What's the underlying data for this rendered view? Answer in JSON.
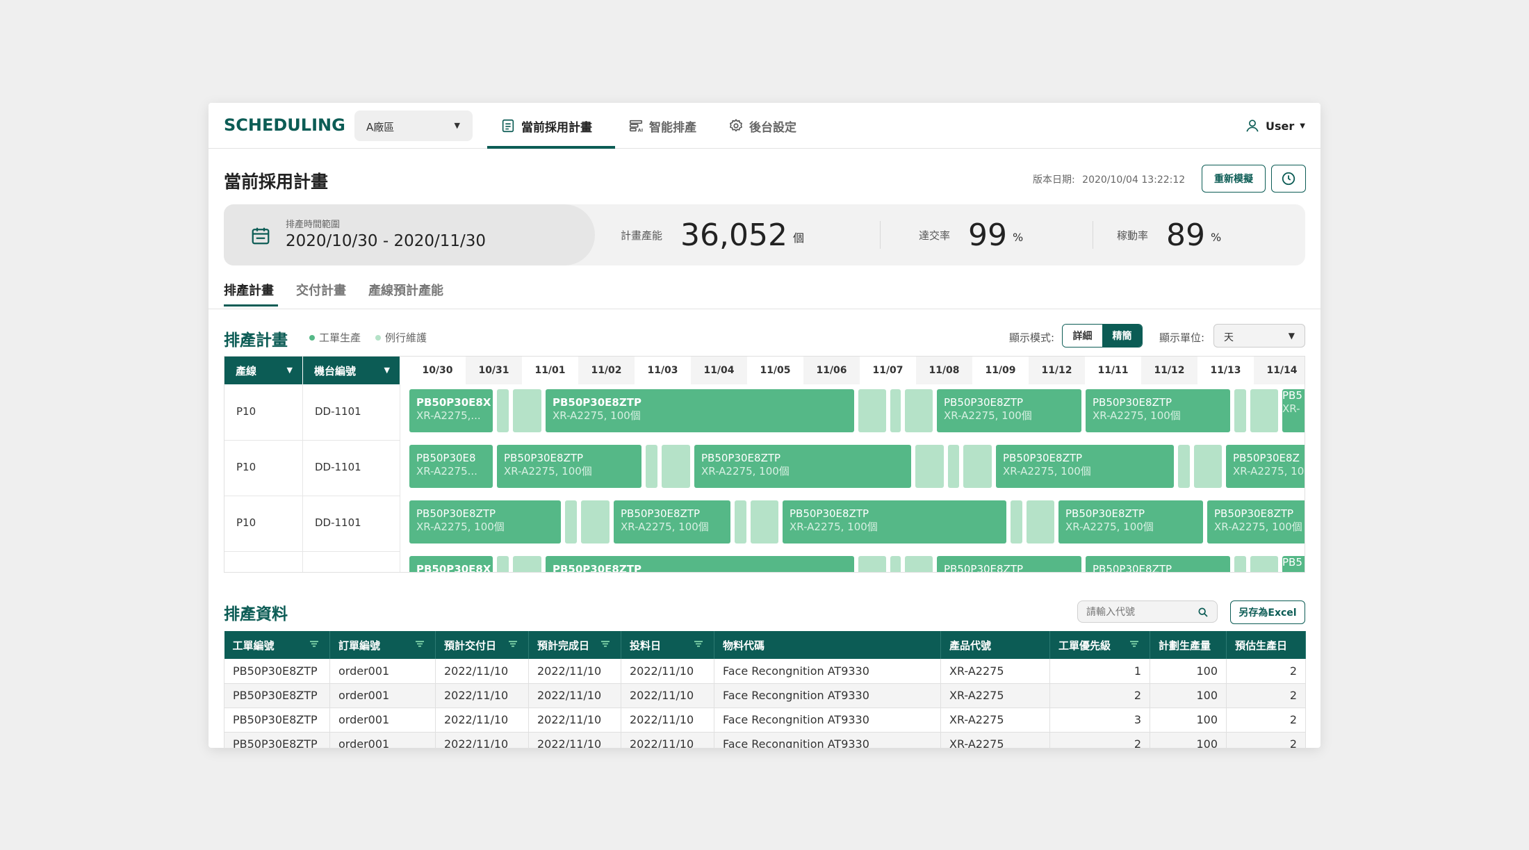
{
  "nav": {
    "logo": "SCHEDULING",
    "factory": "A廠區",
    "tabs": [
      "當前採用計畫",
      "智能排產",
      "後台設定"
    ],
    "user": "User"
  },
  "header": {
    "title": "當前採用計畫",
    "version_label": "版本日期:",
    "version_value": "2020/10/04 13:22:12",
    "resimulate": "重新模擬"
  },
  "summary": {
    "range_label": "排產時間範圍",
    "range_value": "2020/10/30 - 2020/11/30",
    "metrics": [
      {
        "label": "計畫產能",
        "value": "36,052",
        "unit": "個"
      },
      {
        "label": "達交率",
        "value": "99",
        "unit": "%"
      },
      {
        "label": "稼動率",
        "value": "89",
        "unit": "%"
      }
    ]
  },
  "subtabs": [
    "排產計畫",
    "交付計畫",
    "產線預計產能"
  ],
  "gantt": {
    "title": "排產計畫",
    "legend": [
      {
        "label": "工單生產",
        "color": "#55b887"
      },
      {
        "label": "例行維護",
        "color": "#b5e2c8"
      }
    ],
    "mode_label": "顯示模式:",
    "mode_options": [
      "詳細",
      "精簡"
    ],
    "unit_label": "顯示單位:",
    "unit_value": "天",
    "col_line": "產線",
    "col_machine": "機台編號",
    "dates": [
      "10/30",
      "10/31",
      "11/01",
      "11/02",
      "11/03",
      "11/04",
      "11/05",
      "11/06",
      "11/07",
      "11/08",
      "11/09",
      "11/12",
      "11/11",
      "11/12",
      "11/13",
      "11/14"
    ],
    "rows": [
      {
        "line": "P10",
        "machine": "DD-1101"
      },
      {
        "line": "P10",
        "machine": "DD-1101"
      },
      {
        "line": "P10",
        "machine": "DD-1101"
      },
      {
        "line": "",
        "machine": ""
      }
    ],
    "bars": {
      "t1": "PB50P30E8ZTP",
      "t1_short": "PB50P30E8X",
      "t1_short2": "PB50P30E8",
      "t1_stub": "PB5",
      "t1_cut": "PB50P30E8Z",
      "t2": "XR-A2275, 100個",
      "t2_short": "XR-A2275,...",
      "t2_short2": "XR-A2275...",
      "t2_stub": "XR-",
      "t2_cut": "XR-A2275, 10"
    }
  },
  "table": {
    "title": "排產資料",
    "search_placeholder": "請輸入代號",
    "excel": "另存為Excel",
    "headers": [
      "工單編號",
      "訂單編號",
      "預計交付日",
      "預計完成日",
      "投料日",
      "物料代碼",
      "產品代號",
      "工單優先級",
      "計劃生產量",
      "預估生產日"
    ],
    "rows": [
      [
        "PB50P30E8ZTP",
        "order001",
        "2022/11/10",
        "2022/11/10",
        "2022/11/10",
        "Face Recongnition AT9330",
        "XR-A2275",
        "1",
        "100",
        "2"
      ],
      [
        "PB50P30E8ZTP",
        "order001",
        "2022/11/10",
        "2022/11/10",
        "2022/11/10",
        "Face Recongnition AT9330",
        "XR-A2275",
        "2",
        "100",
        "2"
      ],
      [
        "PB50P30E8ZTP",
        "order001",
        "2022/11/10",
        "2022/11/10",
        "2022/11/10",
        "Face Recongnition AT9330",
        "XR-A2275",
        "3",
        "100",
        "2"
      ],
      [
        "PB50P30E8ZTP",
        "order001",
        "2022/11/10",
        "2022/11/10",
        "2022/11/10",
        "Face Recongnition AT9330",
        "XR-A2275",
        "2",
        "100",
        "2"
      ]
    ]
  }
}
